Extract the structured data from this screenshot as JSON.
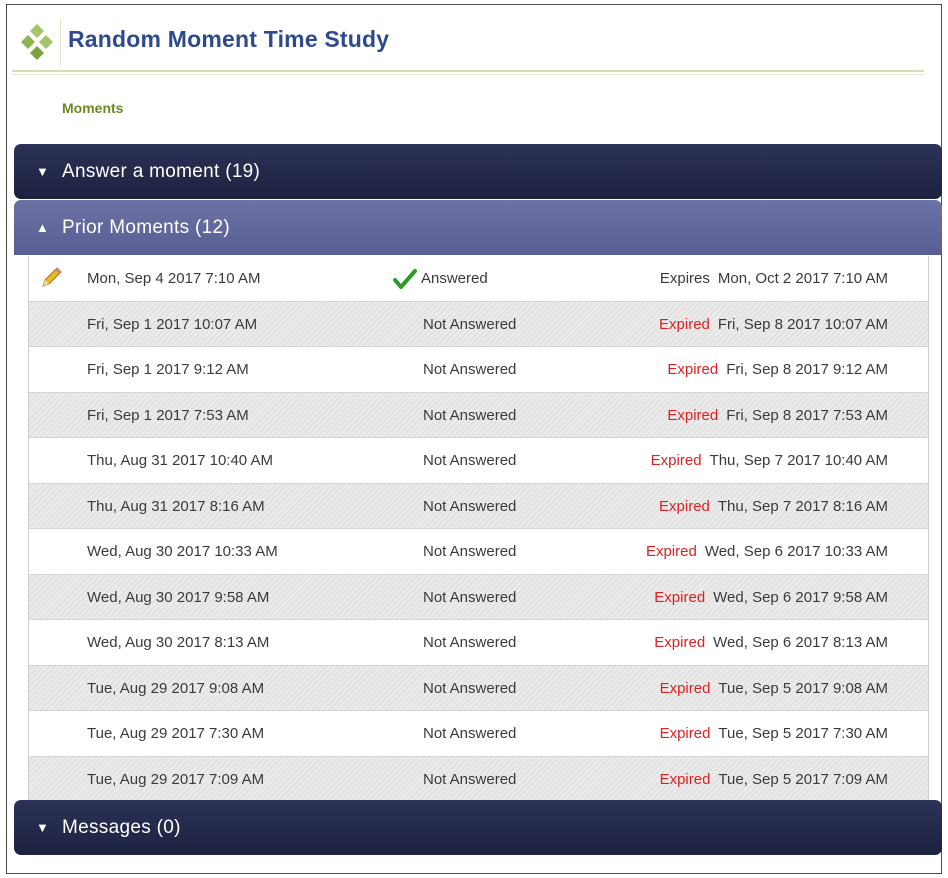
{
  "app": {
    "title": "Random Moment Time Study"
  },
  "breadcrumb": {
    "label": "Moments"
  },
  "panels": {
    "answer": {
      "label": "Answer a moment (19)",
      "arrow": "▼"
    },
    "prior": {
      "label": "Prior Moments (12)",
      "arrow": "▲"
    },
    "messages": {
      "label": "Messages (0)",
      "arrow": "▼"
    }
  },
  "icons": {
    "edit": "pencil-icon",
    "answered": "checkmark-icon",
    "logo": "diamond-cluster-icon"
  },
  "colors": {
    "title": "#2e4a8c",
    "breadcrumb": "#6a8a1f",
    "expired": "#e02020",
    "check": "#2f9a2a",
    "bar_dark": "#23284a",
    "bar_purple": "#62689c"
  },
  "rows": [
    {
      "date": "Mon, Sep 4 2017 7:10 AM",
      "status": "Answered",
      "exp_label": "Expires",
      "exp_date": "Mon, Oct 2 2017 7:10 AM"
    },
    {
      "date": "Fri, Sep 1 2017 10:07 AM",
      "status": "Not Answered",
      "exp_label": "Expired",
      "exp_date": "Fri, Sep 8 2017 10:07 AM"
    },
    {
      "date": "Fri, Sep 1 2017 9:12 AM",
      "status": "Not Answered",
      "exp_label": "Expired",
      "exp_date": "Fri, Sep 8 2017 9:12 AM"
    },
    {
      "date": "Fri, Sep 1 2017 7:53 AM",
      "status": "Not Answered",
      "exp_label": "Expired",
      "exp_date": "Fri, Sep 8 2017 7:53 AM"
    },
    {
      "date": "Thu, Aug 31 2017 10:40 AM",
      "status": "Not Answered",
      "exp_label": "Expired",
      "exp_date": "Thu, Sep 7 2017 10:40 AM"
    },
    {
      "date": "Thu, Aug 31 2017 8:16 AM",
      "status": "Not Answered",
      "exp_label": "Expired",
      "exp_date": "Thu, Sep 7 2017 8:16 AM"
    },
    {
      "date": "Wed, Aug 30 2017 10:33 AM",
      "status": "Not Answered",
      "exp_label": "Expired",
      "exp_date": "Wed, Sep 6 2017 10:33 AM"
    },
    {
      "date": "Wed, Aug 30 2017 9:58 AM",
      "status": "Not Answered",
      "exp_label": "Expired",
      "exp_date": "Wed, Sep 6 2017 9:58 AM"
    },
    {
      "date": "Wed, Aug 30 2017 8:13 AM",
      "status": "Not Answered",
      "exp_label": "Expired",
      "exp_date": "Wed, Sep 6 2017 8:13 AM"
    },
    {
      "date": "Tue, Aug 29 2017 9:08 AM",
      "status": "Not Answered",
      "exp_label": "Expired",
      "exp_date": "Tue, Sep 5 2017 9:08 AM"
    },
    {
      "date": "Tue, Aug 29 2017 7:30 AM",
      "status": "Not Answered",
      "exp_label": "Expired",
      "exp_date": "Tue, Sep 5 2017 7:30 AM"
    },
    {
      "date": "Tue, Aug 29 2017 7:09 AM",
      "status": "Not Answered",
      "exp_label": "Expired",
      "exp_date": "Tue, Sep 5 2017 7:09 AM"
    }
  ]
}
